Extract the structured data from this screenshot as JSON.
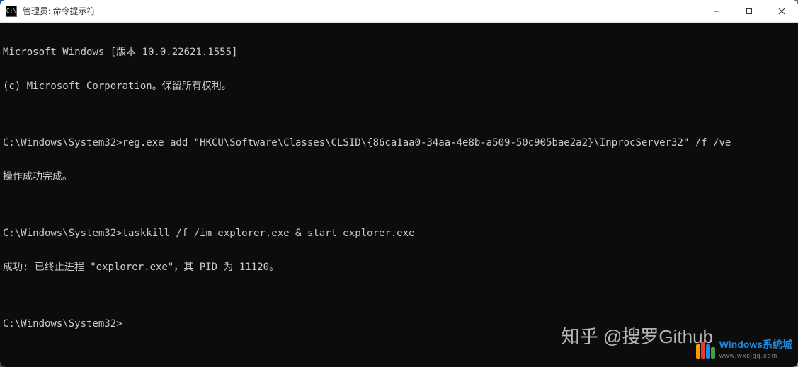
{
  "window": {
    "title": "管理员: 命令提示符",
    "icon_label": "C:\\"
  },
  "terminal": {
    "lines": [
      "Microsoft Windows [版本 10.0.22621.1555]",
      "(c) Microsoft Corporation。保留所有权利。",
      "",
      "C:\\Windows\\System32>reg.exe add \"HKCU\\Software\\Classes\\CLSID\\{86ca1aa0-34aa-4e8b-a509-50c905bae2a2}\\InprocServer32\" /f /ve",
      "操作成功完成。",
      "",
      "C:\\Windows\\System32>taskkill /f /im explorer.exe & start explorer.exe",
      "成功: 已终止进程 \"explorer.exe\"，其 PID 为 11120。",
      "",
      "C:\\Windows\\System32>"
    ]
  },
  "watermarks": {
    "zhihu": "知乎 @搜罗Github",
    "site_name": "Windows系统城",
    "site_url": "www.wxclgg.com"
  }
}
